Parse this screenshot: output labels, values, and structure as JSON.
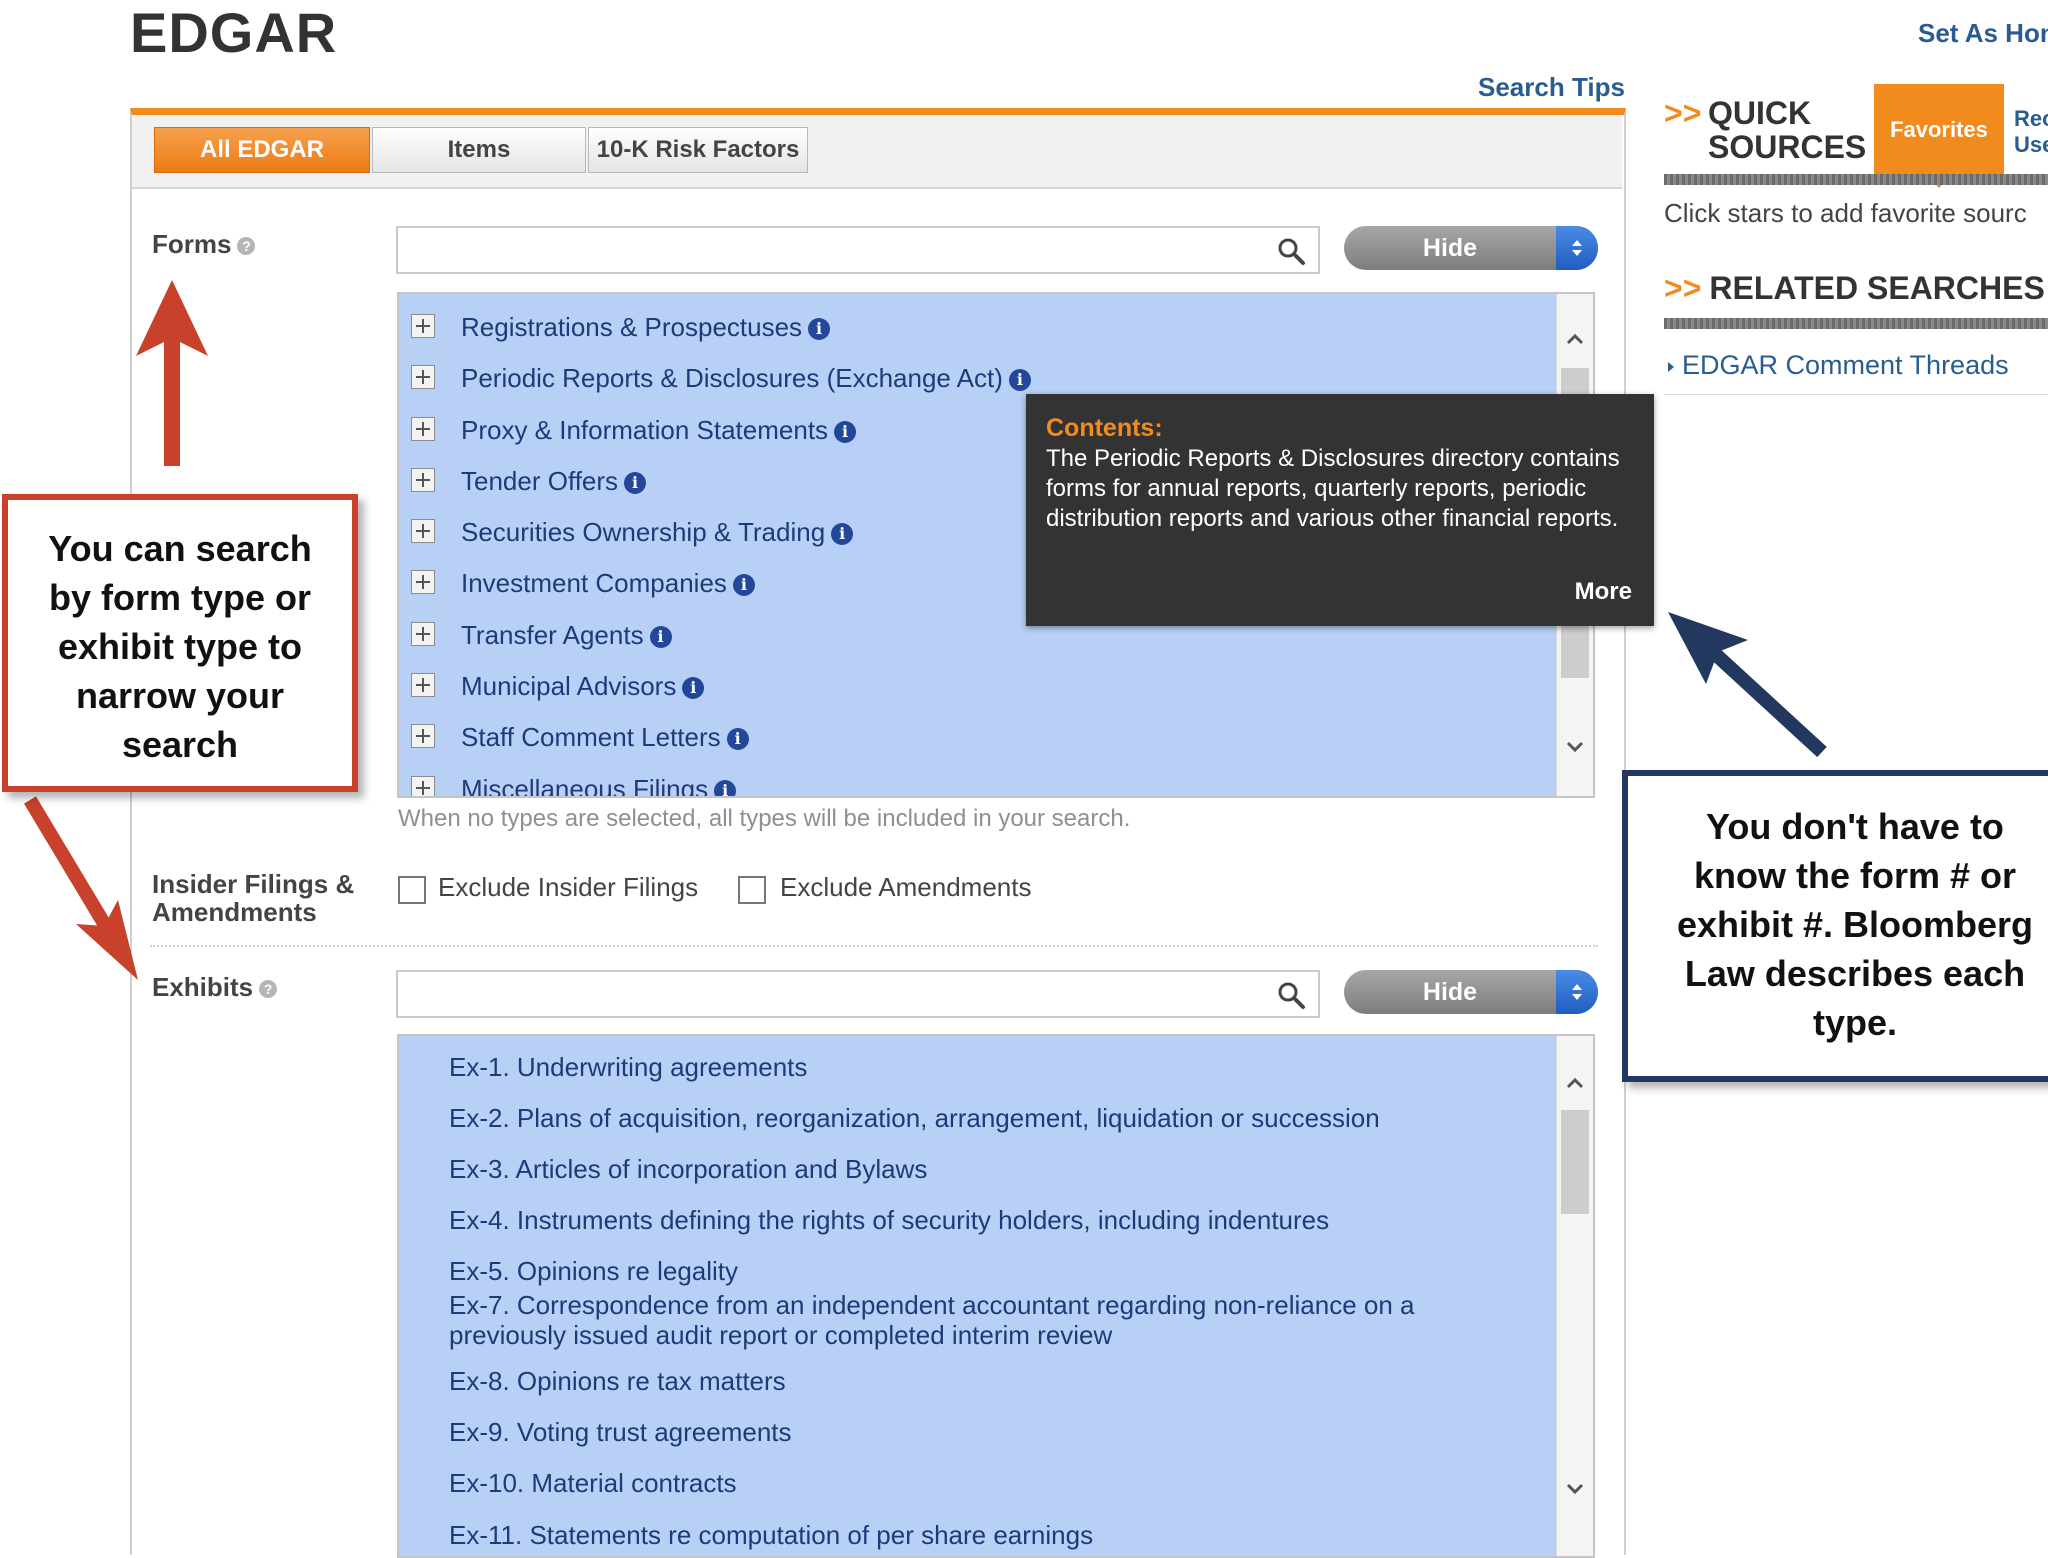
{
  "header": {
    "title": "EDGAR",
    "set_as_home": "Set As Hon",
    "search_tips": "Search Tips"
  },
  "tabs": [
    {
      "label": "All EDGAR",
      "active": true
    },
    {
      "label": "Items",
      "active": false
    },
    {
      "label": "10-K Risk Factors",
      "active": false
    }
  ],
  "forms": {
    "label": "Forms",
    "search_value": "",
    "hide_label": "Hide",
    "items": [
      "Registrations & Prospectuses",
      "Periodic Reports & Disclosures (Exchange Act)",
      "Proxy & Information Statements",
      "Tender Offers",
      "Securities Ownership & Trading",
      "Investment Companies",
      "Transfer Agents",
      "Municipal Advisors",
      "Staff Comment Letters",
      "Miscellaneous Filings"
    ],
    "hint": "When no types are selected, all types will be included in your search."
  },
  "tooltip": {
    "heading": "Contents:",
    "body": "The Periodic Reports & Disclosures directory contains forms for annual reports, quarterly reports, periodic distribution reports and various other financial reports.",
    "more": "More"
  },
  "insider": {
    "label_line1": "Insider Filings &",
    "label_line2": "Amendments",
    "exclude_insider": "Exclude Insider Filings",
    "exclude_amendments": "Exclude Amendments"
  },
  "exhibits": {
    "label": "Exhibits",
    "search_value": "",
    "hide_label": "Hide",
    "items": [
      "Ex-1. Underwriting agreements",
      "Ex-2. Plans of acquisition, reorganization, arrangement, liquidation or succession",
      "Ex-3. Articles of incorporation and Bylaws",
      "Ex-4. Instruments defining the rights of security holders, including indentures",
      "Ex-5. Opinions re legality",
      "Ex-7. Correspondence from an independent accountant regarding non-reliance on a",
      "previously issued audit report or completed interim review",
      "Ex-8. Opinions re tax matters",
      "Ex-9. Voting trust agreements",
      "Ex-10. Material contracts",
      "Ex-11. Statements re computation of per share earnings"
    ]
  },
  "right_column": {
    "chevrons": ">>",
    "quick_sources_line1": "QUICK",
    "quick_sources_line2": "SOURCES",
    "favorites_tab": "Favorites",
    "recent_line1": "Rec",
    "recent_line2": "Use",
    "note": "Click stars to add favorite sourc",
    "related_heading": "RELATED SEARCHES",
    "related_link": "EDGAR Comment Threads"
  },
  "callouts": {
    "left": [
      "You can search",
      "by form type or",
      "exhibit type to",
      "narrow your",
      "search"
    ],
    "right": [
      "You don't have to",
      "know the form # or",
      "exhibit #.  Bloomberg",
      "Law describes each",
      "type."
    ]
  },
  "colors": {
    "accent_orange": "#f28b1e",
    "link_blue": "#2a5d8f",
    "list_bg": "#b9d0f6",
    "callout_red": "#c8412a",
    "callout_navy": "#23385e"
  }
}
